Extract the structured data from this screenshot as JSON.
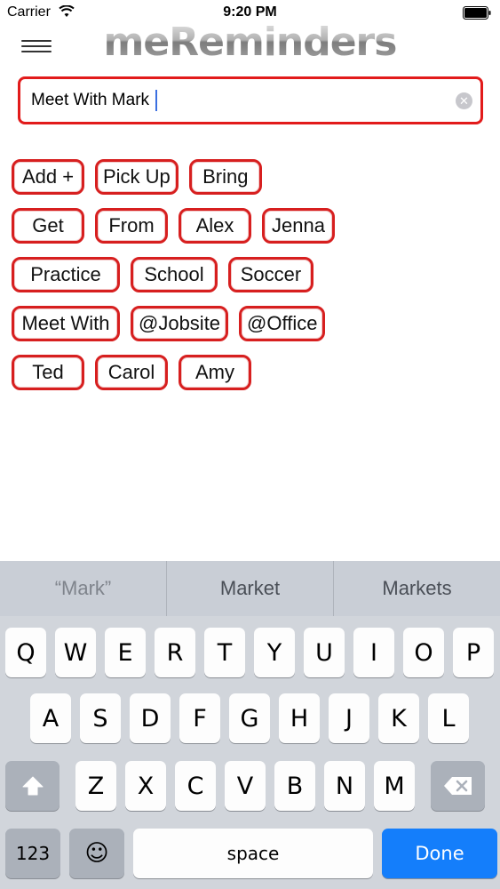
{
  "status_bar": {
    "carrier": "Carrier",
    "time": "9:20 PM"
  },
  "header": {
    "logo": "meReminders",
    "menu_icon": "hamburger-icon"
  },
  "search": {
    "value": "Meet With Mark",
    "clear_icon": "clear-icon"
  },
  "tags": {
    "rows": [
      [
        "Add +",
        "Pick Up",
        "Bring"
      ],
      [
        "Get",
        "From",
        "Alex",
        "Jenna"
      ],
      [
        "Practice",
        "School",
        "Soccer"
      ],
      [
        "Meet With",
        "@Jobsite",
        "@Office"
      ],
      [
        "Ted",
        "Carol",
        "Amy"
      ]
    ]
  },
  "keyboard": {
    "suggestions": [
      "“Mark”",
      "Market",
      "Markets"
    ],
    "row1": [
      "Q",
      "W",
      "E",
      "R",
      "T",
      "Y",
      "U",
      "I",
      "O",
      "P"
    ],
    "row2": [
      "A",
      "S",
      "D",
      "F",
      "G",
      "H",
      "J",
      "K",
      "L"
    ],
    "row3": [
      "Z",
      "X",
      "C",
      "V",
      "B",
      "N",
      "M"
    ],
    "numbers_label": "123",
    "space_label": "space",
    "done_label": "Done",
    "accent_color": "#147efb"
  },
  "colors": {
    "tag_border": "#d71f1f",
    "input_border": "#e21b1b"
  }
}
